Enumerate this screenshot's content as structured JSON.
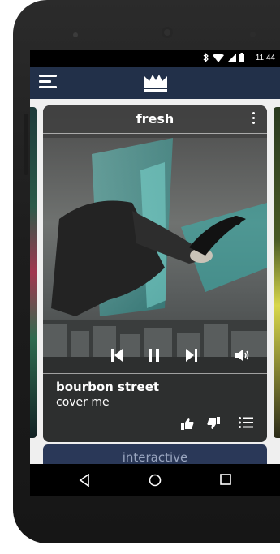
{
  "status_bar": {
    "time": "11:44",
    "icons": [
      "bluetooth-icon",
      "wifi-icon",
      "signal-icon",
      "battery-icon"
    ]
  },
  "app_bar": {
    "menu_icon": "hamburger-menu-icon",
    "logo_icon": "crown-icon"
  },
  "player_card": {
    "station": "fresh",
    "track_title": "bourbon street",
    "track_subtitle": "cover me",
    "controls": [
      "skip-previous-icon",
      "pause-icon",
      "skip-next-icon",
      "volume-icon"
    ],
    "actions": [
      "thumbs-up-icon",
      "thumbs-down-icon",
      "playlist-icon"
    ]
  },
  "next_card": {
    "label": "interactive"
  },
  "nav_bar": {
    "buttons": [
      "back-icon",
      "home-icon",
      "recents-icon"
    ]
  },
  "colors": {
    "app_bar": "#223049",
    "background": "#efefef",
    "next_card": "#2a3858"
  }
}
